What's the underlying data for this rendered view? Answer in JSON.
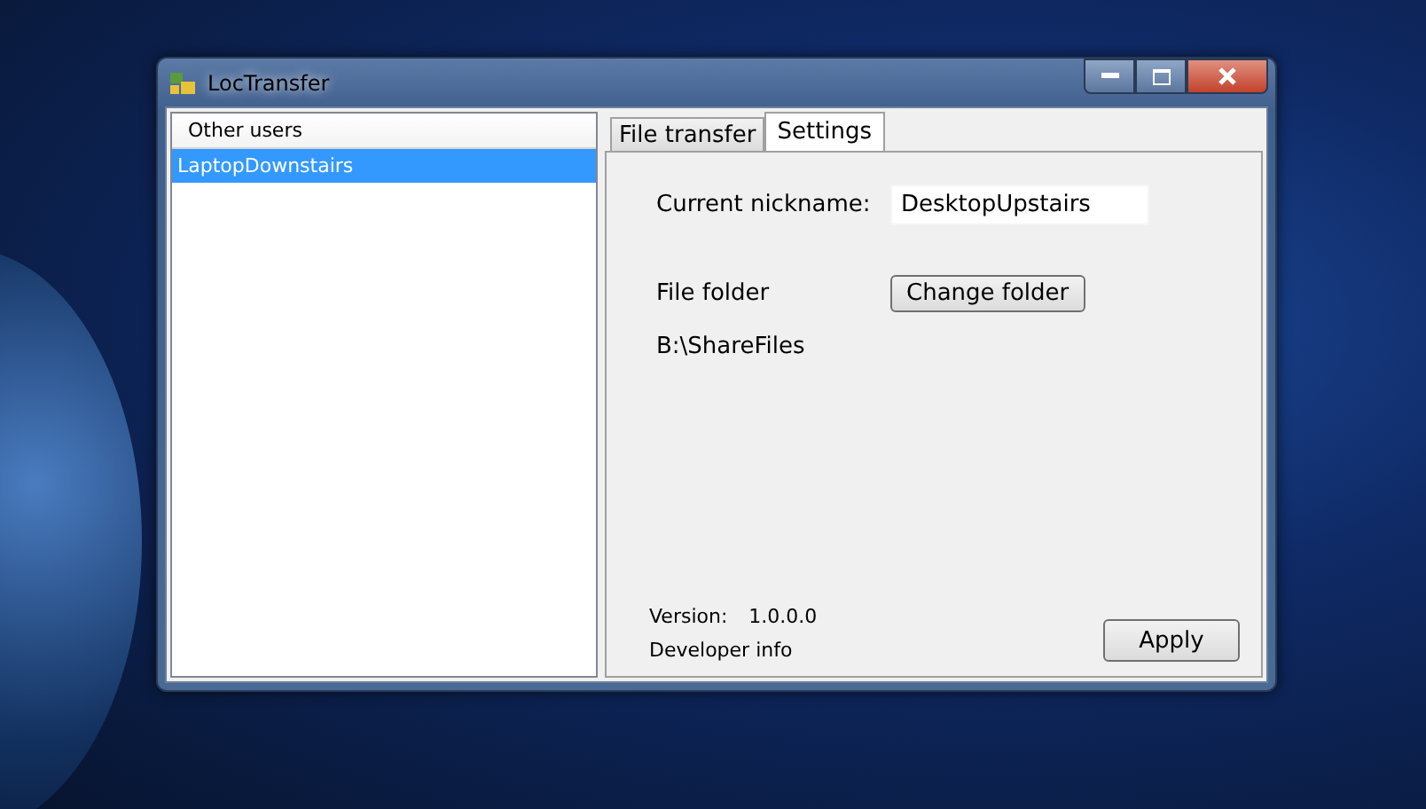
{
  "window": {
    "title": "LocTransfer"
  },
  "users_list": {
    "header": "Other users",
    "items": [
      {
        "label": "LaptopDownstairs",
        "selected": true
      }
    ]
  },
  "tabs": [
    {
      "label": "File transfer",
      "selected": false
    },
    {
      "label": "Settings",
      "selected": true
    }
  ],
  "settings": {
    "nickname_label": "Current nickname:",
    "nickname_value": "DesktopUpstairs",
    "folder_label": "File folder",
    "change_folder_button": "Change folder",
    "folder_path": "B:\\ShareFiles",
    "version_label": "Version:",
    "version_value": "1.0.0.0",
    "developer_info": "Developer info",
    "apply_button": "Apply"
  }
}
